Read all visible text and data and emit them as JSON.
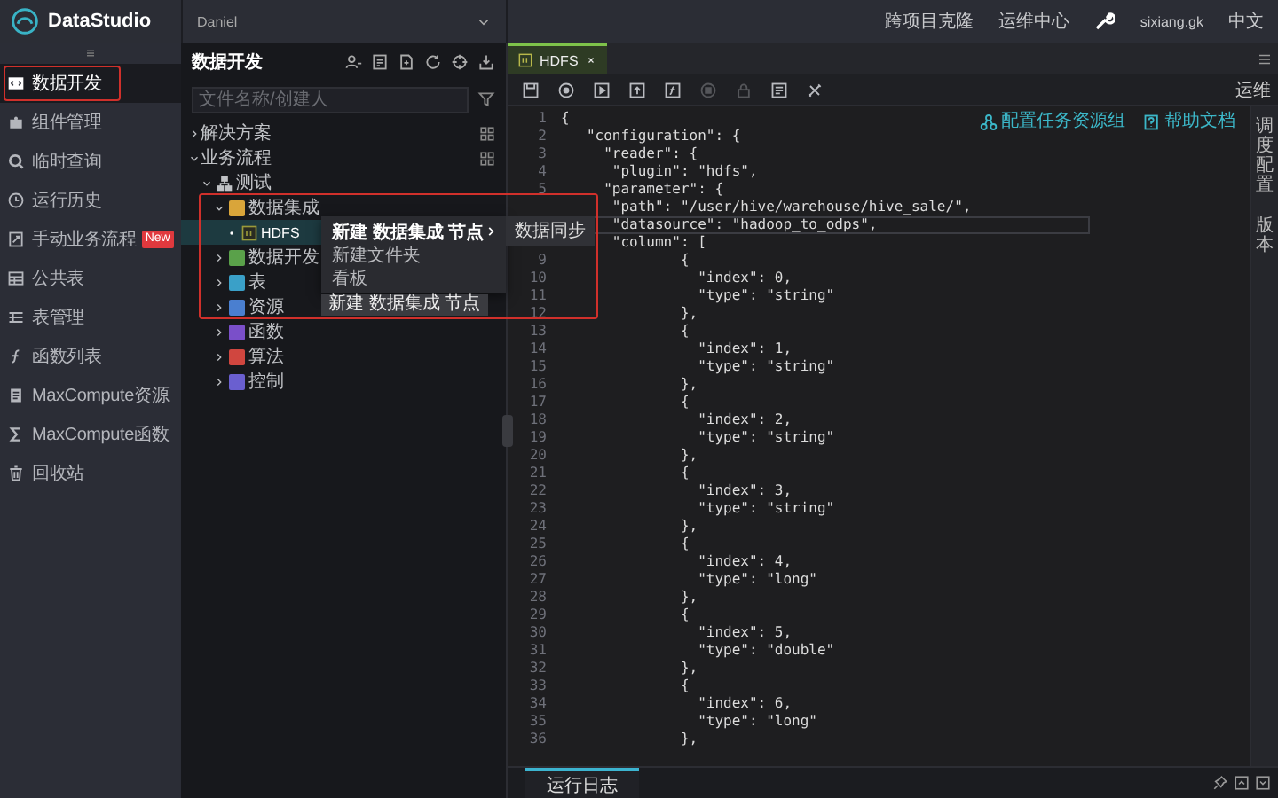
{
  "topbar": {
    "app_name": "DataStudio",
    "project": "Daniel",
    "links": [
      "跨项目克隆",
      "运维中心"
    ],
    "user": "sixiang.gk",
    "language": "中文"
  },
  "nav": {
    "items": [
      {
        "label": "数据开发",
        "selected": true
      },
      {
        "label": "组件管理",
        "selected": false
      },
      {
        "label": "临时查询",
        "selected": false
      },
      {
        "label": "运行历史",
        "selected": false
      },
      {
        "label": "手动业务流程",
        "selected": false,
        "badge": "New"
      },
      {
        "label": "公共表",
        "selected": false
      },
      {
        "label": "表管理",
        "selected": false
      },
      {
        "label": "函数列表",
        "selected": false
      },
      {
        "label": "MaxCompute资源",
        "selected": false
      },
      {
        "label": "MaxCompute函数",
        "selected": false
      },
      {
        "label": "回收站",
        "selected": false
      }
    ]
  },
  "tree_panel": {
    "title": "数据开发",
    "search": {
      "placeholder": "文件名称/创建人"
    },
    "items": [
      {
        "label": "解决方案",
        "selected": false,
        "expanded": false
      },
      {
        "label": "业务流程",
        "selected": false,
        "expanded": true,
        "children": [
          {
            "label": "测试",
            "selected": false,
            "expanded": true,
            "children": [
              {
                "label": "数据集成",
                "selected": false,
                "expanded": true,
                "color": "#d9a53a",
                "children": [
                  {
                    "label": "HDFS",
                    "selected": true
                  }
                ]
              },
              {
                "label": "数据开发",
                "selected": false,
                "expanded": false,
                "color": "#5aa14a"
              },
              {
                "label": "表",
                "selected": false,
                "expanded": false,
                "color": "#3aa0c8"
              },
              {
                "label": "资源",
                "selected": false,
                "expanded": false,
                "color": "#4a7fd0"
              },
              {
                "label": "函数",
                "selected": false,
                "expanded": false,
                "color": "#7a4fc9"
              },
              {
                "label": "算法",
                "selected": false,
                "expanded": false,
                "color": "#d0463f"
              },
              {
                "label": "控制",
                "selected": false,
                "expanded": false,
                "color": "#6a5fd0"
              }
            ]
          }
        ]
      }
    ]
  },
  "context_menu": {
    "items": [
      {
        "label": "新建 数据集成 节点",
        "selected": true,
        "has_submenu": true
      },
      {
        "label": "新建文件夹",
        "selected": false,
        "has_submenu": false
      },
      {
        "label": "看板",
        "selected": false,
        "has_submenu": false
      }
    ],
    "submenu": [
      "数据同步"
    ],
    "tooltip": "新建 数据集成 节点"
  },
  "editor": {
    "tabs": [
      {
        "label": "HDFS",
        "selected": true
      }
    ],
    "toolbar": [
      {
        "disabled": false
      },
      {
        "disabled": false
      },
      {
        "disabled": false
      },
      {
        "disabled": false
      },
      {
        "disabled": false
      },
      {
        "disabled": true
      },
      {
        "disabled": true
      },
      {
        "disabled": false
      },
      {
        "disabled": false
      }
    ],
    "toolbar_label": "运维",
    "links": [
      "配置任务资源组",
      "帮助文档"
    ],
    "lines": [
      {
        "number": "1",
        "text": "{",
        "current": false
      },
      {
        "number": "2",
        "text": "   \"configuration\": {",
        "current": false
      },
      {
        "number": "3",
        "text": "     \"reader\": {",
        "current": false
      },
      {
        "number": "4",
        "text": "      \"plugin\": \"hdfs\",",
        "current": false
      },
      {
        "number": "5",
        "text": "     \"parameter\": {",
        "current": false
      },
      {
        "text": "      \"path\": \"/user/hive/warehouse/hive_sale/\",",
        "current": false
      },
      {
        "text": "      \"datasource\": \"hadoop_to_odps\",",
        "current": true
      },
      {
        "text": "      \"column\": [",
        "current": false
      },
      {
        "number": "9",
        "text": "              {",
        "current": false
      },
      {
        "number": "10",
        "text": "                \"index\": 0,",
        "current": false
      },
      {
        "number": "11",
        "text": "                \"type\": \"string\"",
        "current": false
      },
      {
        "number": "12",
        "text": "              },",
        "current": false
      },
      {
        "number": "13",
        "text": "              {",
        "current": false
      },
      {
        "number": "14",
        "text": "                \"index\": 1,",
        "current": false
      },
      {
        "number": "15",
        "text": "                \"type\": \"string\"",
        "current": false
      },
      {
        "number": "16",
        "text": "              },",
        "current": false
      },
      {
        "number": "17",
        "text": "              {",
        "current": false
      },
      {
        "number": "18",
        "text": "                \"index\": 2,",
        "current": false
      },
      {
        "number": "19",
        "text": "                \"type\": \"string\"",
        "current": false
      },
      {
        "number": "20",
        "text": "              },",
        "current": false
      },
      {
        "number": "21",
        "text": "              {",
        "current": false
      },
      {
        "number": "22",
        "text": "                \"index\": 3,",
        "current": false
      },
      {
        "number": "23",
        "text": "                \"type\": \"string\"",
        "current": false
      },
      {
        "number": "24",
        "text": "              },",
        "current": false
      },
      {
        "number": "25",
        "text": "              {",
        "current": false
      },
      {
        "number": "26",
        "text": "                \"index\": 4,",
        "current": false
      },
      {
        "number": "27",
        "text": "                \"type\": \"long\"",
        "current": false
      },
      {
        "number": "28",
        "text": "              },",
        "current": false
      },
      {
        "number": "29",
        "text": "              {",
        "current": false
      },
      {
        "number": "30",
        "text": "                \"index\": 5,",
        "current": false
      },
      {
        "number": "31",
        "text": "                \"type\": \"double\"",
        "current": false
      },
      {
        "number": "32",
        "text": "              },",
        "current": false
      },
      {
        "number": "33",
        "text": "              {",
        "current": false
      },
      {
        "number": "34",
        "text": "                \"index\": 6,",
        "current": false
      },
      {
        "number": "35",
        "text": "                \"type\": \"long\"",
        "current": false
      },
      {
        "number": "36",
        "text": "              },",
        "current": false
      }
    ]
  },
  "side_strip": {
    "tabs": [
      "调度配置",
      "版本"
    ]
  },
  "bottom_panel": {
    "tabs": [
      {
        "label": "运行日志",
        "selected": true
      }
    ]
  }
}
